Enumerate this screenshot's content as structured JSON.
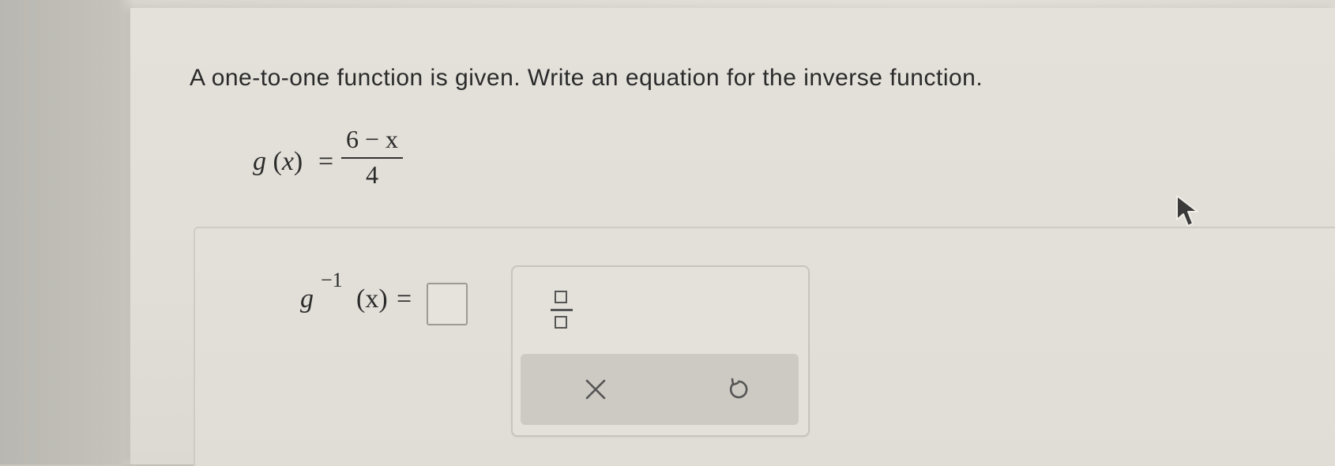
{
  "question": {
    "prompt": "A one-to-one function is given. Write an equation for the inverse function."
  },
  "given_function": {
    "name": "g",
    "variable": "x",
    "equals": "=",
    "numerator": "6 − x",
    "denominator": "4"
  },
  "inverse": {
    "name": "g",
    "superscript": "−1",
    "variable": "(x)",
    "equals": "="
  },
  "answer": {
    "value": ""
  },
  "toolbox": {
    "tools": [
      {
        "name": "fraction",
        "icon": "fraction-icon"
      }
    ],
    "actions": [
      {
        "name": "clear",
        "icon": "close-icon"
      },
      {
        "name": "reset",
        "icon": "undo-icon"
      }
    ]
  },
  "colors": {
    "text": "#2a2a2a",
    "panel_border": "#cfccc5",
    "action_bar": "#cdcac3",
    "highlight": "#6eaaff"
  }
}
